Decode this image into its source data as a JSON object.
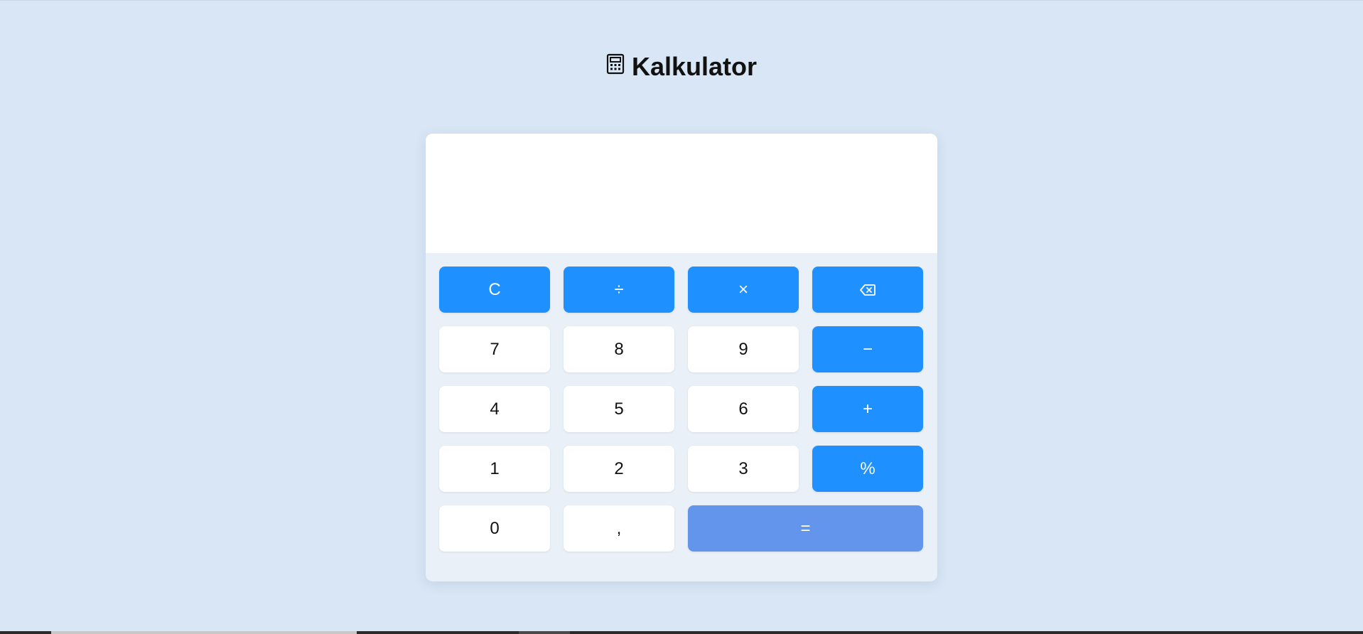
{
  "page": {
    "title": "Kalkulator",
    "title_icon": "calculator-icon"
  },
  "display": {
    "value": ""
  },
  "keys": [
    {
      "label": "C",
      "kind": "op",
      "name": "clear-button"
    },
    {
      "label": "÷",
      "kind": "op",
      "name": "divide-button"
    },
    {
      "label": "×",
      "kind": "op",
      "name": "multiply-button"
    },
    {
      "label": "",
      "kind": "op",
      "name": "backspace-button",
      "icon": "backspace-icon"
    },
    {
      "label": "7",
      "kind": "num",
      "name": "digit-7-button"
    },
    {
      "label": "8",
      "kind": "num",
      "name": "digit-8-button"
    },
    {
      "label": "9",
      "kind": "num",
      "name": "digit-9-button"
    },
    {
      "label": "−",
      "kind": "op",
      "name": "subtract-button"
    },
    {
      "label": "4",
      "kind": "num",
      "name": "digit-4-button"
    },
    {
      "label": "5",
      "kind": "num",
      "name": "digit-5-button"
    },
    {
      "label": "6",
      "kind": "num",
      "name": "digit-6-button"
    },
    {
      "label": "+",
      "kind": "op",
      "name": "add-button"
    },
    {
      "label": "1",
      "kind": "num",
      "name": "digit-1-button"
    },
    {
      "label": "2",
      "kind": "num",
      "name": "digit-2-button"
    },
    {
      "label": "3",
      "kind": "num",
      "name": "digit-3-button"
    },
    {
      "label": "%",
      "kind": "op",
      "name": "percent-button"
    },
    {
      "label": "0",
      "kind": "num",
      "name": "digit-0-button"
    },
    {
      "label": ",",
      "kind": "num",
      "name": "decimal-comma-button"
    },
    {
      "label": "=",
      "kind": "equals",
      "name": "equals-button"
    }
  ],
  "colors": {
    "background": "#d8e6f5",
    "operator": "#1e90ff",
    "equals": "#6495ed",
    "number_key": "#ffffff"
  }
}
